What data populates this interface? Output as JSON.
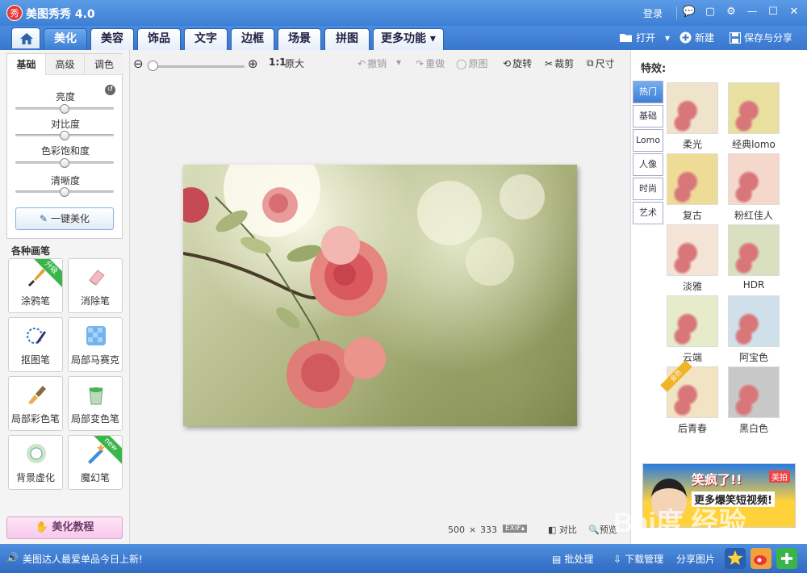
{
  "window": {
    "logo_text": "秀",
    "title": "美图秀秀 4.0",
    "login": "登录",
    "controls": [
      "💬",
      "▢",
      "⚙",
      "—",
      "☐",
      "✕"
    ]
  },
  "tabs": [
    {
      "label": "美化",
      "active": true
    },
    {
      "label": "美容",
      "active": false
    },
    {
      "label": "饰品",
      "active": false
    },
    {
      "label": "文字",
      "active": false
    },
    {
      "label": "边框",
      "active": false
    },
    {
      "label": "场景",
      "active": false
    },
    {
      "label": "拼图",
      "active": false
    },
    {
      "label": "更多功能 ▾",
      "active": false
    }
  ],
  "tab_actions": {
    "open": "打开",
    "open_arrow": "▾",
    "new": "新建",
    "save": "保存与分享"
  },
  "left": {
    "subtabs": [
      "基础",
      "高级",
      "调色"
    ],
    "reset_glyph": "↺",
    "sliders": [
      {
        "label": "亮度",
        "value": 0.5
      },
      {
        "label": "对比度",
        "value": 0.5
      },
      {
        "label": "色彩饱和度",
        "value": 0.5
      },
      {
        "label": "清晰度",
        "value": 0.5
      }
    ],
    "one_key": "一键美化",
    "brushes_title": "各种画笔",
    "tools": [
      {
        "label": "涂鸦笔",
        "badge": "升级",
        "icon": "paintbrush-icon"
      },
      {
        "label": "消除笔",
        "badge": "",
        "icon": "eraser-icon"
      },
      {
        "label": "抠图笔",
        "badge": "",
        "icon": "cutout-pen-icon"
      },
      {
        "label": "局部马赛克",
        "badge": "",
        "icon": "mosaic-icon"
      },
      {
        "label": "局部彩色笔",
        "badge": "",
        "icon": "color-brush-icon"
      },
      {
        "label": "局部变色笔",
        "badge": "",
        "icon": "color-change-icon"
      },
      {
        "label": "背景虚化",
        "badge": "",
        "icon": "blur-background-icon"
      },
      {
        "label": "魔幻笔",
        "badge": "new",
        "icon": "magic-pen-icon"
      }
    ],
    "tutorial": "美化教程"
  },
  "toolbar": {
    "zoom_in": "⊕",
    "zoom_out": "⊖",
    "zoom_level": 0.0,
    "ratio": "1:1",
    "original_size": "原大",
    "undo": "撤销",
    "undo_arrow": "▾",
    "redo": "重做",
    "original": "原图",
    "rotate": "旋转",
    "crop": "裁剪",
    "size": "尺寸"
  },
  "image_info": {
    "width": "500",
    "x": "×",
    "height": "333",
    "exif": "EXIF▴",
    "compare": "对比",
    "preview": "预览"
  },
  "effects": {
    "title": "特效:",
    "categories": [
      "热门",
      "基础",
      "Lomo",
      "人像",
      "时尚",
      "艺术"
    ],
    "active_category": "热门",
    "items": [
      {
        "label": "柔光",
        "tint": "#efe3cc"
      },
      {
        "label": "经典lomo",
        "tint": "#e9e0a0"
      },
      {
        "label": "复古",
        "tint": "#eedb96"
      },
      {
        "label": "粉红佳人",
        "tint": "#f4d8cc"
      },
      {
        "label": "淡雅",
        "tint": "#f3e4d6"
      },
      {
        "label": "HDR",
        "tint": "#d9e0c0"
      },
      {
        "label": "云端",
        "tint": "#e6ebc9"
      },
      {
        "label": "阿宝色",
        "tint": "#cfe0ea"
      },
      {
        "label": "后青春",
        "tint": "#f2e4c2"
      },
      {
        "label": "黑白色",
        "tint": "#c8c8c8"
      }
    ],
    "item_badge": "会员"
  },
  "ad": {
    "line1": "笑疯了!!",
    "line2": "更多爆笑短视频!",
    "brand": "美拍"
  },
  "status": {
    "speaker": "🔊",
    "marquee": "美图达人最爱单品今日上新!",
    "batch": "批处理",
    "download": "下载管理",
    "share": "分享图片"
  },
  "watermark": {
    "main": "Bai度 经验",
    "url": "jingyan.baidu.com"
  },
  "colors": {
    "accent": "#3d7fd4",
    "tab_active": "#3b7dd3",
    "ribbon_green": "#3ab54a"
  }
}
